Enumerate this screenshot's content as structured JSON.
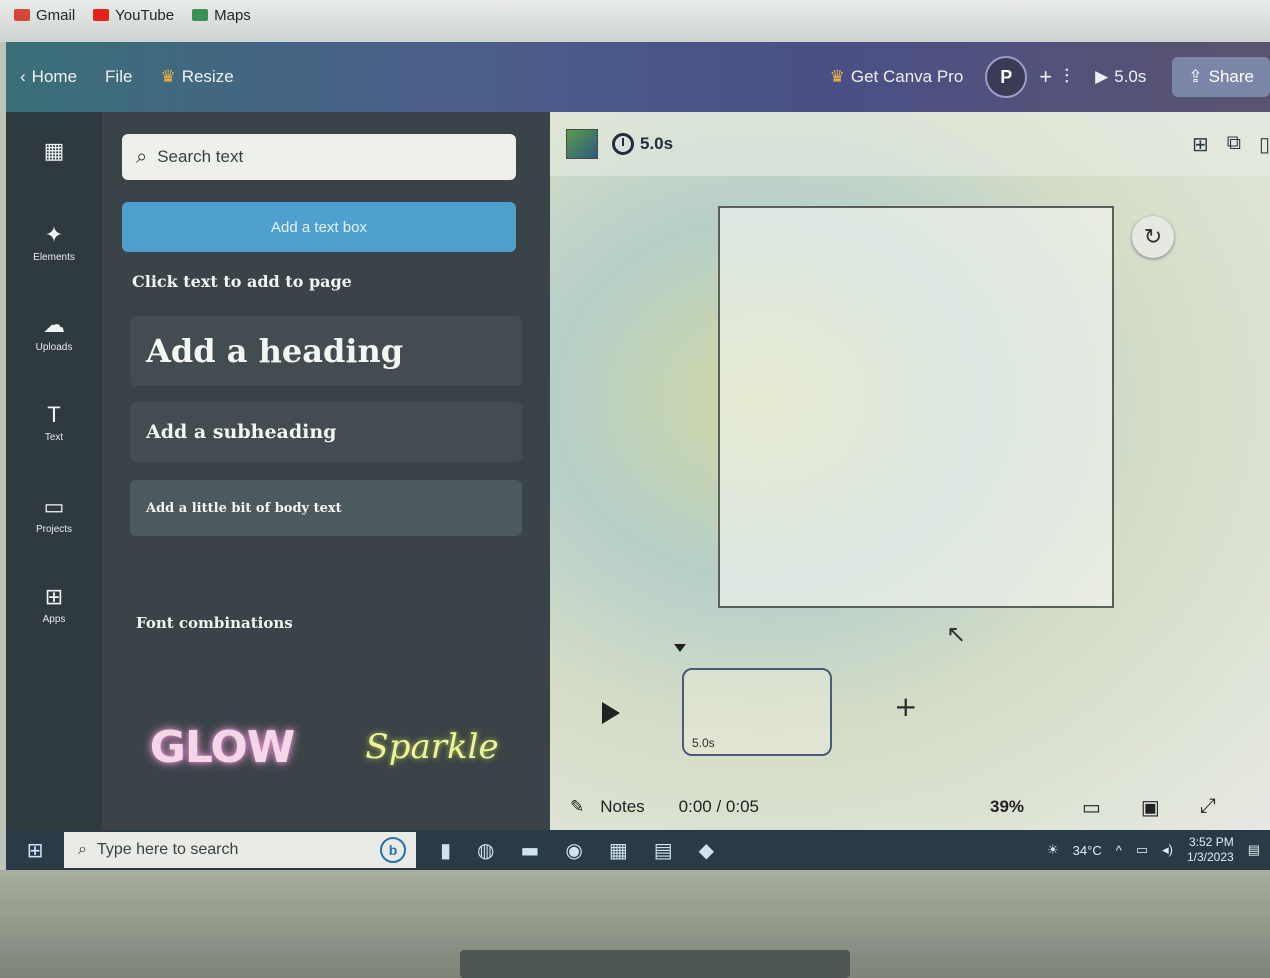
{
  "browser": {
    "bookmarks": [
      {
        "label": "Gmail",
        "icon": "gmail-icon"
      },
      {
        "label": "YouTube",
        "icon": "youtube-icon"
      },
      {
        "label": "Maps",
        "icon": "maps-icon"
      }
    ]
  },
  "topbar": {
    "home": "Home",
    "file": "File",
    "resize": "Resize",
    "pro": "Get Canva Pro",
    "avatar": "P",
    "duration": "5.0s",
    "share": "Share"
  },
  "rail": {
    "items": [
      {
        "label": "Elements",
        "icon": "elements-icon"
      },
      {
        "label": "Uploads",
        "icon": "uploads-icon"
      },
      {
        "label": "Text",
        "icon": "text-icon"
      },
      {
        "label": "Projects",
        "icon": "projects-icon"
      },
      {
        "label": "Apps",
        "icon": "apps-icon"
      }
    ]
  },
  "panel": {
    "search_placeholder": "Search text",
    "add_textbox": "Add a text box",
    "hint": "Click text to add to page",
    "heading": "Add a heading",
    "subheading": "Add a subheading",
    "body": "Add a little bit of body text",
    "font_combinations": "Font combinations",
    "combo_glow": "GLOW",
    "combo_sparkle": "Sparkle"
  },
  "workspace": {
    "duration": "5.0s",
    "clip_duration": "5.0s",
    "notes": "Notes",
    "time": "0:00 / 0:05",
    "zoom": "39%"
  },
  "taskbar": {
    "search_placeholder": "Type here to search",
    "weather": "34°C",
    "time": "3:52 PM",
    "date": "1/3/2023"
  }
}
